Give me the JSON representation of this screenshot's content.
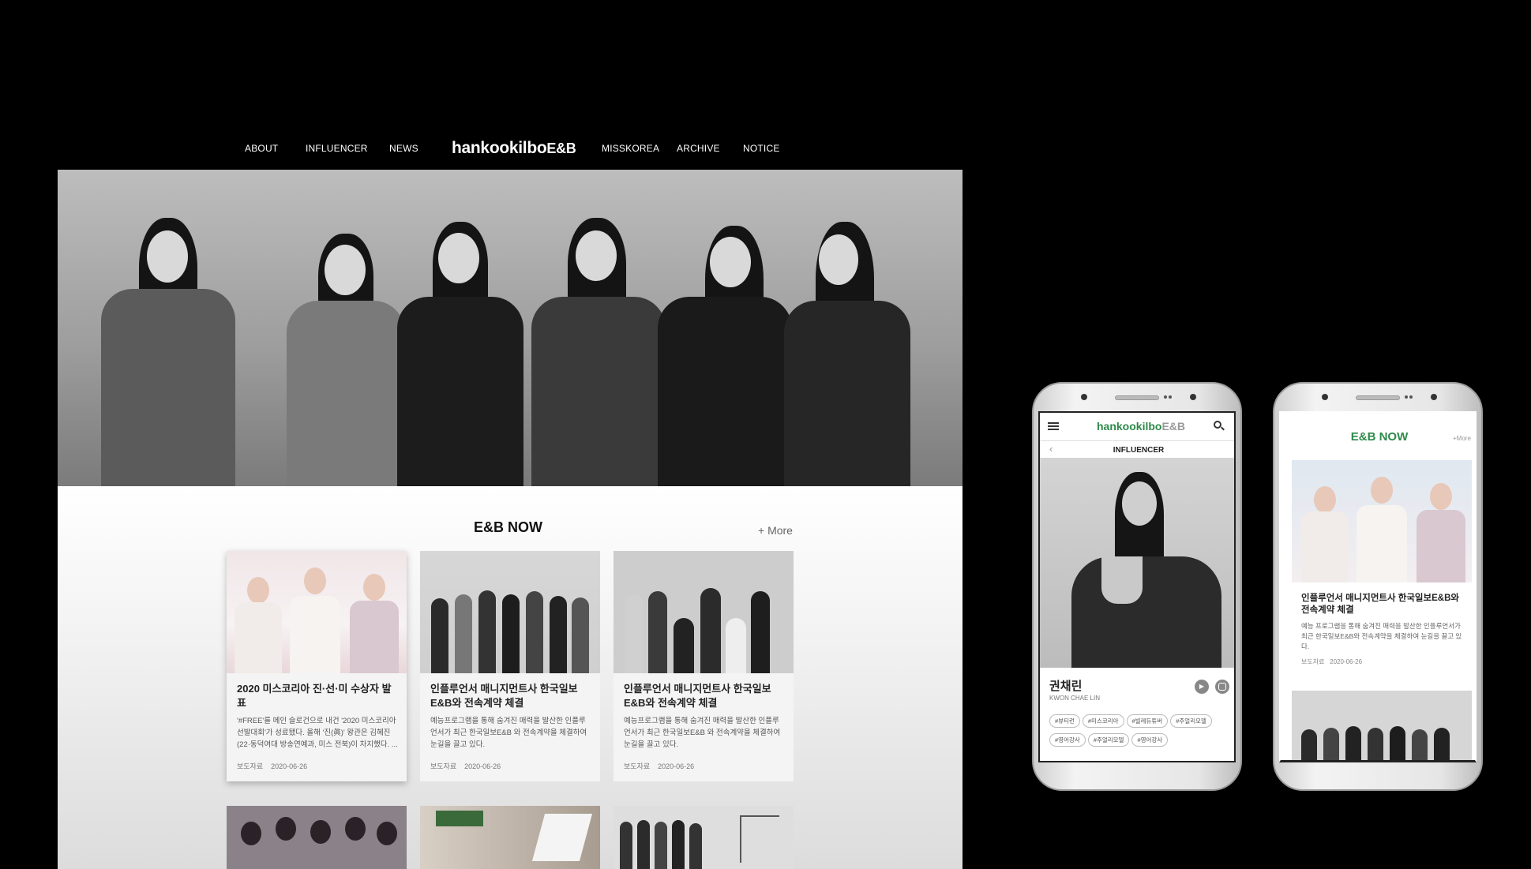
{
  "nav": {
    "left": [
      "ABOUT",
      "INFLUENCER",
      "NEWS"
    ],
    "logo_main": "hankookilbo",
    "logo_suffix": "E&B",
    "right": [
      "MISSKOREA",
      "ARCHIVE",
      "NOTICE"
    ]
  },
  "section": {
    "title": "E&B NOW",
    "more": "+ More"
  },
  "cards": [
    {
      "title": "2020 미스코리아 진·선·미 수상자 발표",
      "desc": "'#FREE'를 메인 슬로건으로 내건 '2020 미스코리아 선발대회'가 성료됐다. 올해 '진(眞)' 왕관은 김혜진(22·동덕여대 방송연예과, 미스 전북)이 차지했다. ...",
      "source": "보도자료",
      "date": "2020-06-26"
    },
    {
      "title": "인플루언서 매니지먼트사 한국일보E&B와 전속계약 체결",
      "desc": "예능프로그램을 통해 숨겨진 매력을 발산한 인플루언서가 최근 한국일보E&B 와 전속계약을 체결하여 눈길을 끌고 있다.",
      "source": "보도자료",
      "date": "2020-06-26"
    },
    {
      "title": "인플루언서 매니지먼트사 한국일보E&B와 전속계약 체결",
      "desc": "예능프로그램을 통해 숨겨진 매력을 발산한 인플루언서가 최근 한국일보E&B 와 전속계약을 체결하여 눈길을 끌고 있다.",
      "source": "보도자료",
      "date": "2020-06-26"
    }
  ],
  "phone1": {
    "logo_main": "hankookilbo",
    "logo_suffix": "E&B",
    "subtitle": "INFLUENCER",
    "name_ko": "권채린",
    "name_en": "KWON CHAE LIN",
    "tags": [
      "#뷰티런",
      "#미스코리아",
      "#빌레듀튜버",
      "#주얼리모델",
      "#영어강사",
      "#주얼리모델",
      "#영어강사"
    ]
  },
  "phone2": {
    "title": "E&B NOW",
    "more": "+More",
    "card_title": "인플루언서 매니지먼트사 한국일보E&B와 전속계약 체결",
    "card_desc": "예능 프로그램을 통해 숨겨진 매력을 발산한 인플루언서가 최근 한국일보E&B와 전속계약을 체결하여 눈길을 끌고 있다.",
    "source": "보도자료",
    "date": "2020-06-26"
  }
}
